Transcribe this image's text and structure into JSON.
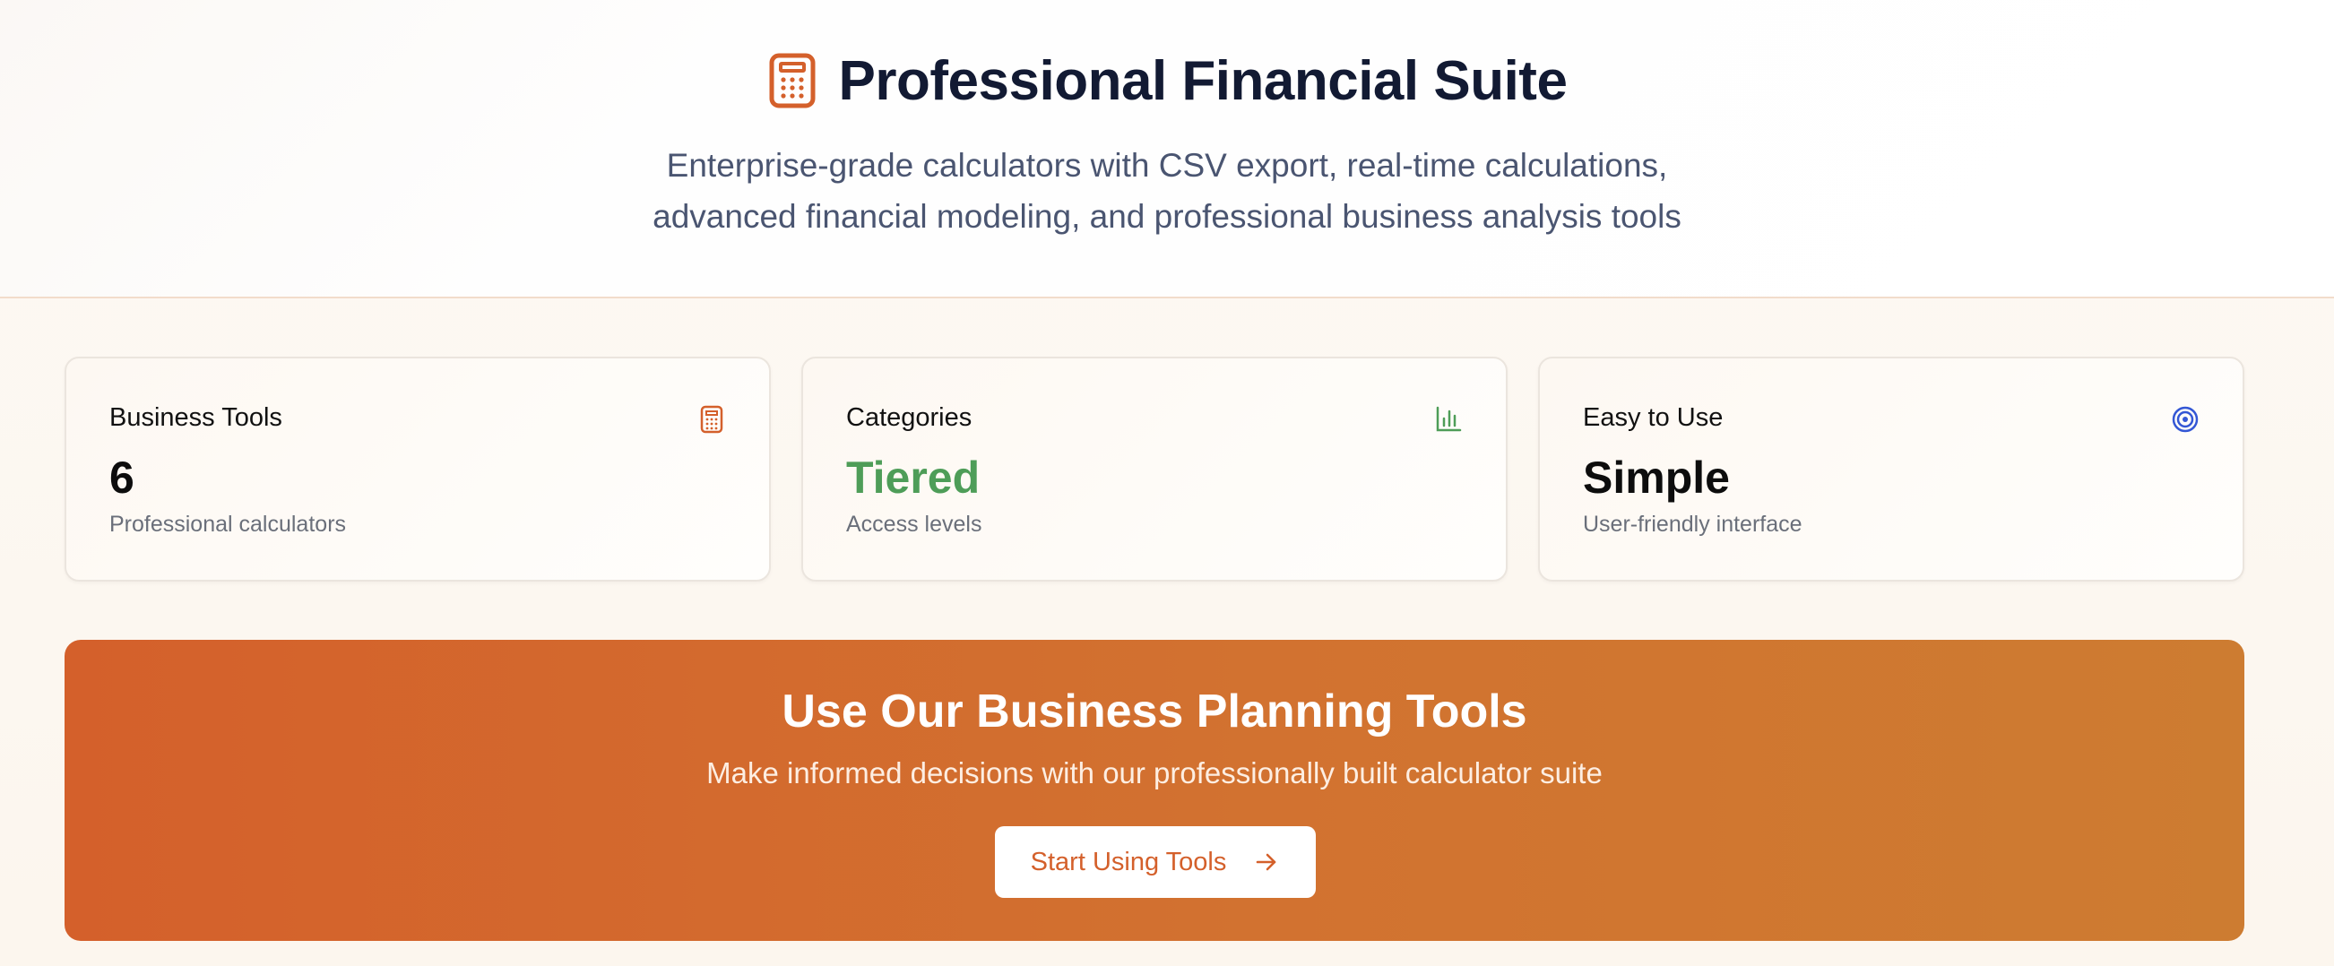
{
  "header": {
    "title": "Professional Financial Suite",
    "subtitle_line1": "Enterprise-grade calculators with CSV export, real-time calculations,",
    "subtitle_line2": "advanced financial modeling, and professional business analysis tools",
    "icon": "calculator-icon"
  },
  "stats": [
    {
      "label": "Business Tools",
      "value": "6",
      "caption": "Professional calculators",
      "icon": "calculator-icon",
      "icon_color": "#d4602b",
      "value_color": "#0d0d0d"
    },
    {
      "label": "Categories",
      "value": "Tiered",
      "caption": "Access levels",
      "icon": "bar-chart-icon",
      "icon_color": "#4e9d58",
      "value_color": "#4e9d58"
    },
    {
      "label": "Easy to Use",
      "value": "Simple",
      "caption": "User-friendly interface",
      "icon": "target-icon",
      "icon_color": "#3457d5",
      "value_color": "#0d0d0d"
    }
  ],
  "cta": {
    "title": "Use Our Business Planning Tools",
    "subtitle": "Make informed decisions with our professionally built calculator suite",
    "button_label": "Start Using Tools",
    "button_icon": "arrow-right-icon"
  },
  "colors": {
    "accent": "#d4602b",
    "title_text": "#121a33",
    "green": "#4e9d58",
    "blue": "#3457d5"
  }
}
